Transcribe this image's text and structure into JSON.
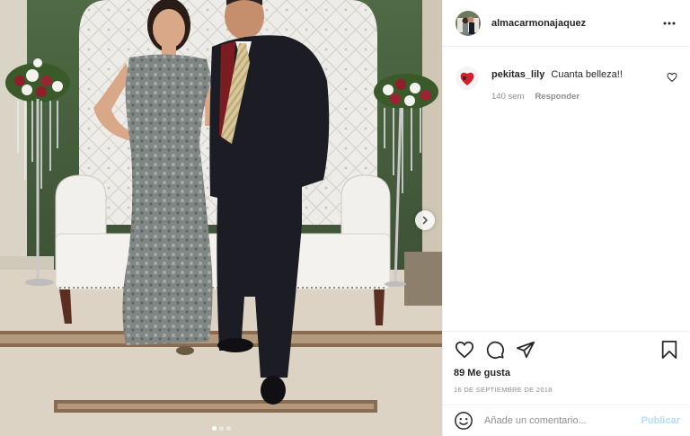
{
  "post": {
    "username": "almacarmonajaquez",
    "carousel": {
      "total": 3,
      "active": 1
    }
  },
  "comments": [
    {
      "user": "pekitas_lily",
      "text": "Cuanta belleza!!",
      "age": "140 sem",
      "reply_label": "Responder"
    }
  ],
  "actions": {
    "likes": "89 Me gusta",
    "date": "16 DE SEPTIEMBRE DE 2018"
  },
  "comment_box": {
    "placeholder": "Añade un comentario...",
    "publish_label": "Publicar"
  },
  "icons": [
    "more-options-icon",
    "next-arrow-icon",
    "heart-icon",
    "comment-icon",
    "share-icon",
    "save-icon",
    "emoji-icon",
    "comment-heart-icon"
  ],
  "colors": {
    "text": "#262626",
    "muted": "#8e8e8e",
    "border": "#efefef",
    "publish_disabled": "#b2dffc"
  }
}
